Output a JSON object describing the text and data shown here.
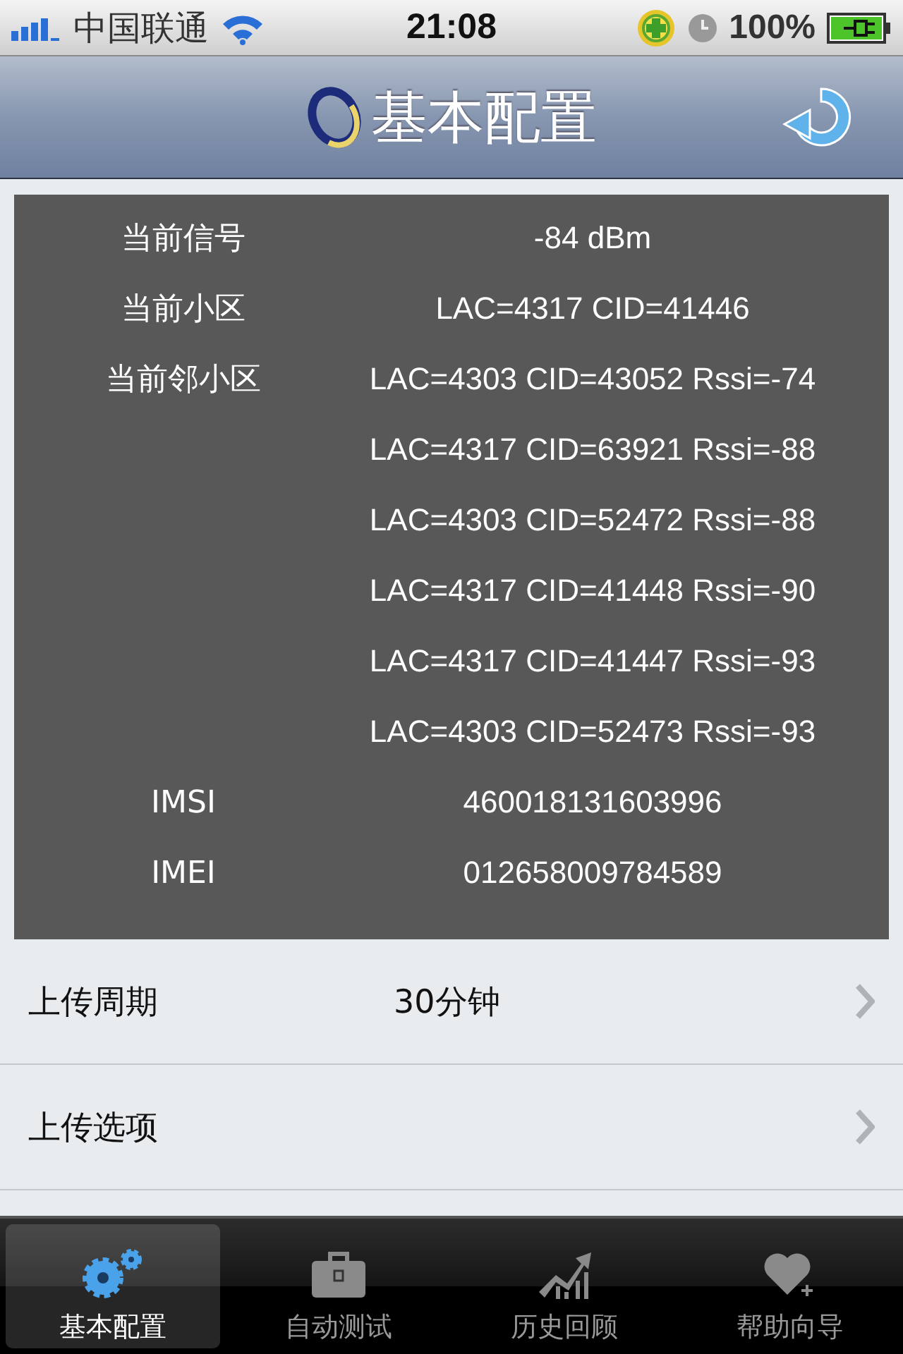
{
  "status_bar": {
    "carrier": "中国联通",
    "time": "21:08",
    "battery": "100%"
  },
  "nav_bar": {
    "title": "基本配置"
  },
  "info": [
    {
      "label": "当前信号",
      "value": "-84 dBm"
    },
    {
      "label": "当前小区",
      "value": "LAC=4317 CID=41446"
    },
    {
      "label": "当前邻小区",
      "value": "LAC=4303 CID=43052 Rssi=-74"
    },
    {
      "value": "LAC=4317 CID=63921 Rssi=-88"
    },
    {
      "value": "LAC=4303 CID=52472 Rssi=-88"
    },
    {
      "value": "LAC=4317 CID=41448 Rssi=-90"
    },
    {
      "value": "LAC=4317 CID=41447 Rssi=-93"
    },
    {
      "value": "LAC=4303 CID=52473 Rssi=-93"
    },
    {
      "label": "IMSI",
      "value": "460018131603996"
    },
    {
      "label": "IMEI",
      "value": "012658009784589"
    }
  ],
  "settings": [
    {
      "label": "上传周期",
      "value": "30分钟"
    },
    {
      "label": "上传选项"
    }
  ],
  "tabs": [
    {
      "label": "基本配置",
      "selected": true
    },
    {
      "label": "自动测试",
      "selected": false
    },
    {
      "label": "历史回顾",
      "selected": false
    },
    {
      "label": "帮助向导",
      "selected": false
    }
  ]
}
